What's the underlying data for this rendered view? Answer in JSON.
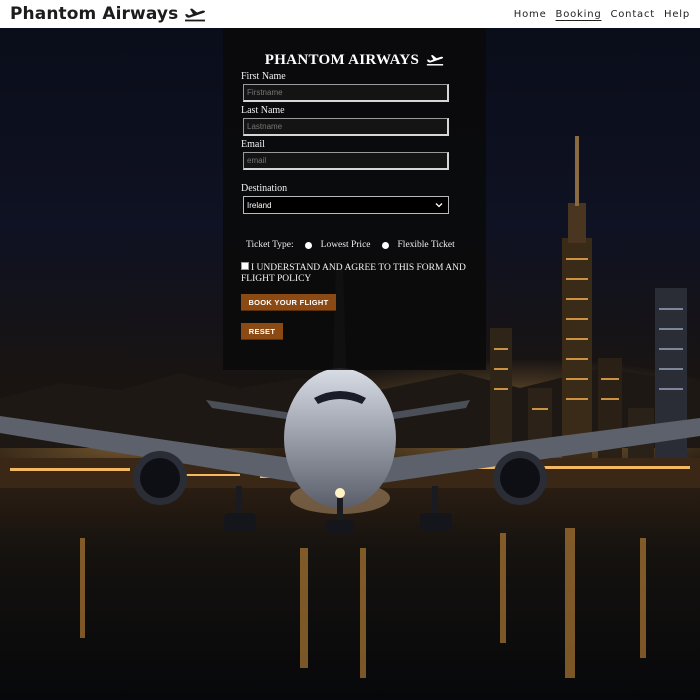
{
  "header": {
    "brand": "Phantom Airways",
    "brand_icon": "airplane-departure-icon",
    "nav": [
      {
        "label": "Home",
        "active": false
      },
      {
        "label": "Booking",
        "active": true
      },
      {
        "label": "Contact",
        "active": false
      },
      {
        "label": "Help",
        "active": false
      }
    ]
  },
  "form": {
    "title": "PHANTOM AIRWAYS",
    "title_icon": "airplane-departure-icon",
    "first_name": {
      "label": "First Name",
      "placeholder": "Firstname",
      "value": ""
    },
    "last_name": {
      "label": "Last Name",
      "placeholder": "Lastname",
      "value": ""
    },
    "email": {
      "label": "Email",
      "placeholder": "email",
      "value": ""
    },
    "destination": {
      "label": "Destination",
      "selected": "Ireland"
    },
    "ticket_type": {
      "label": "Ticket Type:",
      "options": [
        "Lowest Price",
        "Flexible Ticket"
      ]
    },
    "agree_text": "I UNDERSTAND AND AGREE TO THIS FORM AND FLIGHT POLICY",
    "book_button": "BOOK YOUR FLIGHT",
    "reset_button": "RESET"
  },
  "colors": {
    "header_bg": "#ffffff",
    "panel_bg": "#0a0a0a",
    "button_bg": "#8b4a14",
    "city_lights": "#e8a64a"
  }
}
